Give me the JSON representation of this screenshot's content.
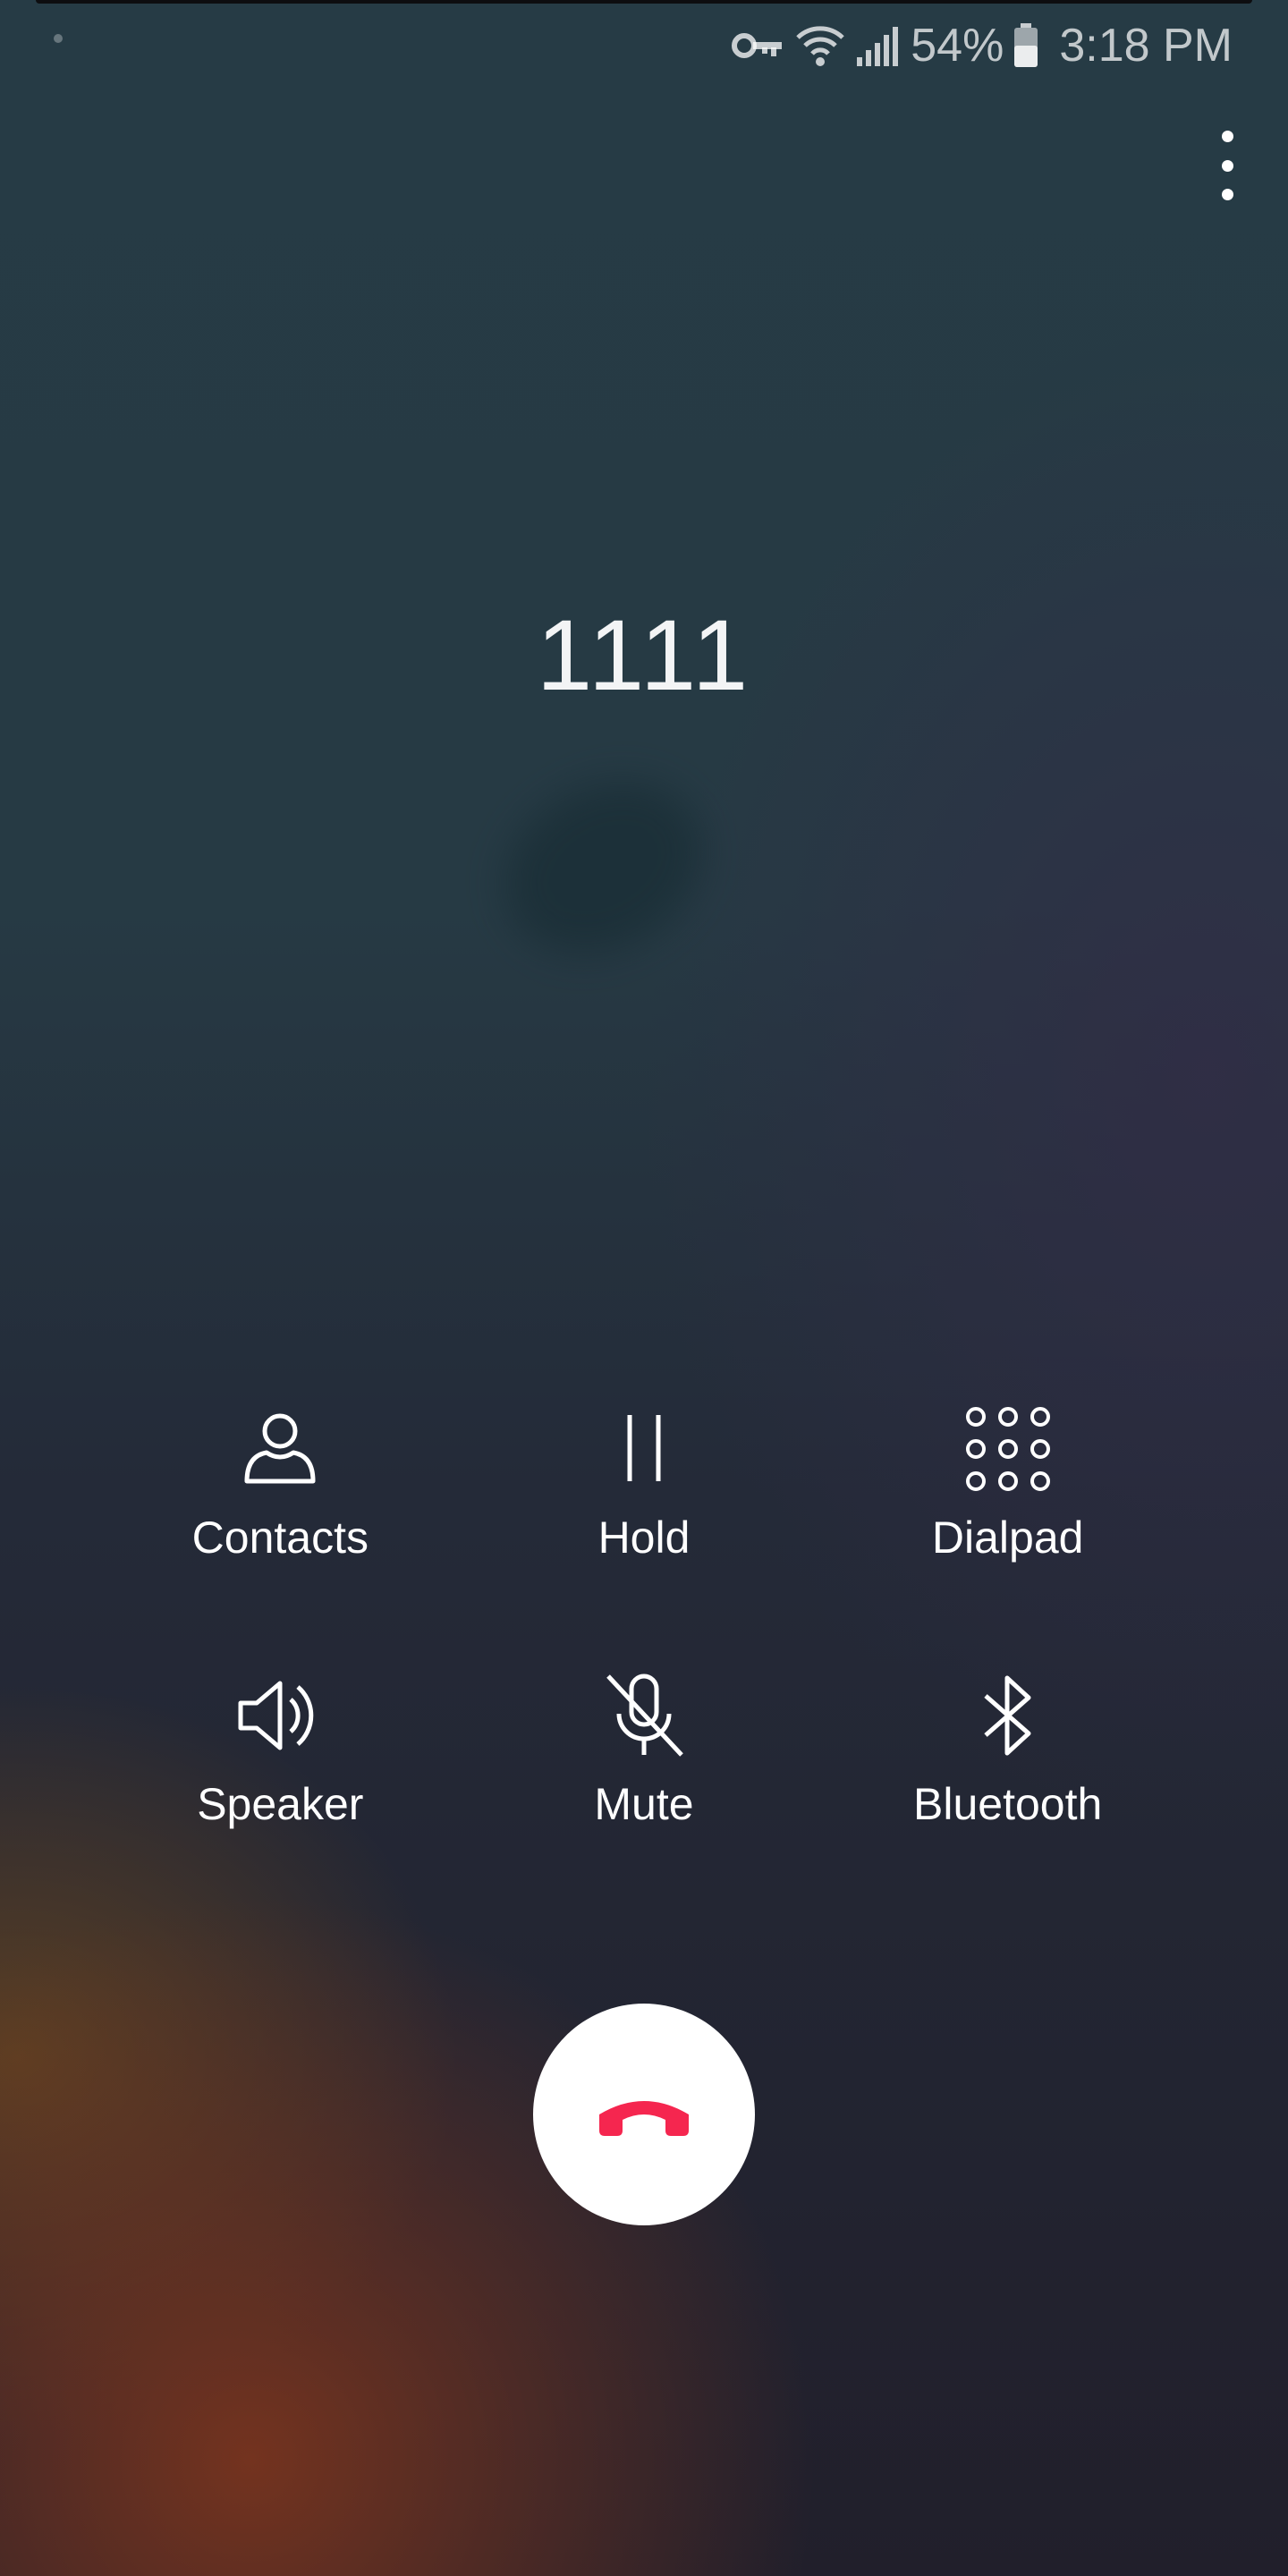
{
  "status_bar": {
    "battery_percent": "54%",
    "time": "3:18 PM",
    "icons": [
      "vpn-key-icon",
      "wifi-icon",
      "cellular-signal-icon",
      "battery-icon"
    ]
  },
  "call": {
    "number": "1111"
  },
  "controls": {
    "contacts": "Contacts",
    "hold": "Hold",
    "dialpad": "Dialpad",
    "speaker": "Speaker",
    "mute": "Mute",
    "bluetooth": "Bluetooth"
  },
  "colors": {
    "end_call": "#f5264f",
    "end_call_button_bg": "#ffffff"
  }
}
